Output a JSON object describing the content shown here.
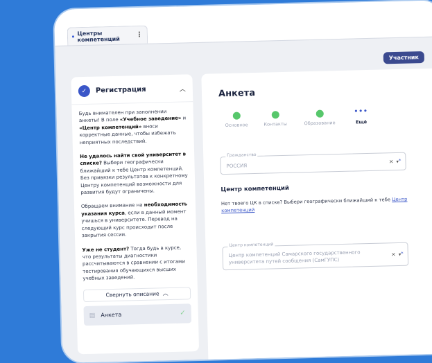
{
  "tab": {
    "label": "Центры компетенций"
  },
  "header": {
    "role_badge": "Участник"
  },
  "sidebar": {
    "title": "Регистрация",
    "paragraphs": [
      {
        "parts": [
          {
            "t": "Будь внимателен при заполнении анкеты! В поле "
          },
          {
            "t": "«Учебное заведение»",
            "b": true
          },
          {
            "t": " и "
          },
          {
            "t": "«Центр компетенций»",
            "b": true
          },
          {
            "t": " вноси корректные данные, чтобы избежать неприятных последствий."
          }
        ]
      },
      {
        "parts": [
          {
            "t": "Не удалось найти свой университет в списке?",
            "b": true
          },
          {
            "t": " Выбери географически ближайший к тебе Центр компетенций. Без привязки результатов к конкретному Центру компетенций возможности для развития будут ограничены."
          }
        ]
      },
      {
        "parts": [
          {
            "t": "Обращаем внимание на "
          },
          {
            "t": "необходимость указания курса",
            "b": true
          },
          {
            "t": ", если в данный момент учишься в университете. Перевод на следующий курс происходит после закрытия сессии."
          }
        ]
      },
      {
        "parts": [
          {
            "t": "Уже не студент?",
            "b": true
          },
          {
            "t": " Тогда будь в курсе, что результаты диагностики рассчитываются в сравнении с итогами тестирования обучающихся высших учебных заведений."
          }
        ]
      }
    ],
    "collapse_label": "Свернуть описание",
    "step_item_label": "Анкета"
  },
  "main": {
    "title": "Анкета",
    "steps": [
      {
        "label": "Основное",
        "state": "done"
      },
      {
        "label": "Контакты",
        "state": "done"
      },
      {
        "label": "Образование",
        "state": "done"
      },
      {
        "label": "Ещё",
        "state": "current"
      }
    ],
    "citizenship": {
      "label": "Гражданство",
      "value": "РОССИЯ"
    },
    "competence_section": {
      "title": "Центр компетенций",
      "text": "Нет твоего ЦК в списке? Выбери географически ближайший к тебе ",
      "link": "Центр компетенций"
    },
    "competence_field": {
      "label": "Центр компетенций",
      "value": "Центр компетенций Самарского государственного университета путей сообщения (СамГУПС)"
    }
  },
  "colors": {
    "background": "#2f7bd8",
    "accent": "#3a56c8",
    "step_done": "#57c76b",
    "badge": "#3b4a8f"
  }
}
